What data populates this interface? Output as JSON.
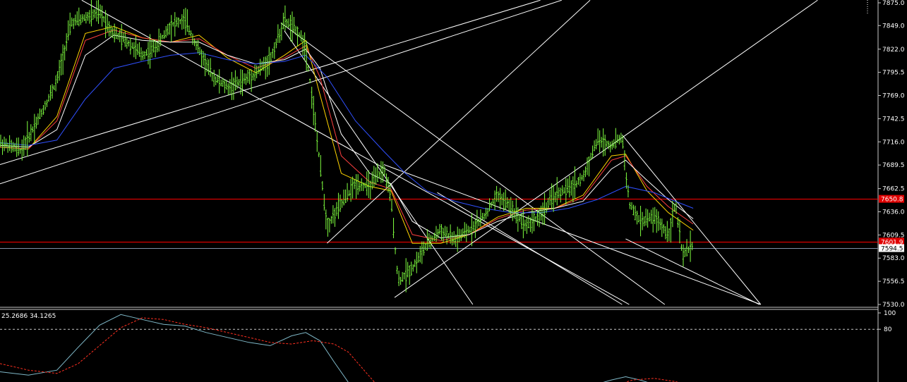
{
  "chart_data": [
    {
      "type": "line",
      "panel": "price",
      "title": "",
      "yticks": [
        7875.0,
        7849.0,
        7822.0,
        7795.5,
        7769.0,
        7742.5,
        7716.0,
        7689.5,
        7662.5,
        7636.0,
        7609.5,
        7583.0,
        7556.5,
        7530.0
      ],
      "ylim": [
        7530.0,
        7878.0
      ],
      "xlim": [
        0,
        1235
      ],
      "grid": false,
      "horizontal_levels": [
        {
          "value": 7650.8,
          "label": "7650.8",
          "color": "#ff0000"
        },
        {
          "value": 7601.9,
          "label": "7601.9",
          "color": "#ff0000"
        },
        {
          "value": 7594.5,
          "label": "7594.5",
          "color": "#7f8fa6"
        }
      ],
      "price_series": {
        "name": "",
        "color": "#7fff3f",
        "x": [
          0,
          30,
          60,
          80,
          100,
          120,
          140,
          160,
          180,
          200,
          220,
          240,
          260,
          280,
          300,
          320,
          340,
          360,
          380,
          400,
          420,
          430,
          440,
          450,
          460,
          480,
          500,
          520,
          540,
          550,
          560,
          580,
          600,
          620,
          640,
          660,
          680,
          700,
          720,
          740,
          760,
          780,
          800,
          820,
          840,
          860,
          875,
          885,
          900,
          920,
          940,
          950,
          960,
          975
        ],
        "y": [
          7715,
          7706,
          7752,
          7785,
          7852,
          7858,
          7864,
          7840,
          7830,
          7815,
          7825,
          7850,
          7855,
          7820,
          7790,
          7778,
          7785,
          7795,
          7810,
          7855,
          7840,
          7825,
          7760,
          7690,
          7620,
          7645,
          7668,
          7665,
          7685,
          7650,
          7556,
          7572,
          7598,
          7615,
          7603,
          7615,
          7630,
          7655,
          7640,
          7620,
          7632,
          7655,
          7662,
          7675,
          7718,
          7712,
          7722,
          7645,
          7625,
          7630,
          7610,
          7645,
          7585,
          7600
        ]
      },
      "moving_averages": [
        {
          "name": "",
          "color": "#ffd400",
          "x": [
            0,
            40,
            80,
            120,
            160,
            200,
            240,
            280,
            320,
            360,
            400,
            430,
            450,
            480,
            520,
            550,
            580,
            620,
            660,
            700,
            740,
            780,
            820,
            860,
            880,
            910,
            940,
            975
          ],
          "y": [
            7710,
            7708,
            7745,
            7840,
            7848,
            7835,
            7830,
            7838,
            7812,
            7795,
            7815,
            7832,
            7770,
            7680,
            7665,
            7660,
            7600,
            7600,
            7610,
            7630,
            7640,
            7640,
            7655,
            7700,
            7702,
            7660,
            7635,
            7615
          ]
        },
        {
          "name": "",
          "color": "#ff4040",
          "x": [
            0,
            40,
            80,
            120,
            160,
            200,
            240,
            280,
            320,
            360,
            400,
            430,
            450,
            480,
            520,
            550,
            580,
            620,
            660,
            700,
            740,
            780,
            820,
            860,
            880,
            910,
            940,
            975
          ],
          "y": [
            7710,
            7708,
            7740,
            7832,
            7844,
            7835,
            7830,
            7834,
            7815,
            7800,
            7812,
            7826,
            7790,
            7700,
            7670,
            7662,
            7610,
            7603,
            7610,
            7628,
            7638,
            7640,
            7652,
            7695,
            7700,
            7665,
            7642,
            7622
          ]
        },
        {
          "name": "",
          "color": "#ffffff",
          "x": [
            0,
            40,
            80,
            120,
            160,
            200,
            240,
            280,
            320,
            360,
            400,
            430,
            450,
            480,
            520,
            550,
            580,
            620,
            660,
            700,
            740,
            780,
            820,
            860,
            880,
            910,
            940,
            975
          ],
          "y": [
            7712,
            7710,
            7730,
            7815,
            7838,
            7832,
            7830,
            7830,
            7815,
            7805,
            7810,
            7822,
            7800,
            7725,
            7680,
            7668,
            7625,
            7606,
            7610,
            7625,
            7635,
            7640,
            7648,
            7685,
            7695,
            7672,
            7650,
            7628
          ]
        },
        {
          "name": "",
          "color": "#3050ff",
          "x": [
            0,
            40,
            80,
            120,
            160,
            200,
            240,
            280,
            320,
            360,
            400,
            430,
            460,
            500,
            540,
            570,
            600,
            640,
            680,
            720,
            760,
            800,
            840,
            880,
            920,
            950,
            975
          ],
          "y": [
            7715,
            7712,
            7718,
            7765,
            7800,
            7808,
            7815,
            7818,
            7810,
            7805,
            7808,
            7815,
            7790,
            7740,
            7705,
            7680,
            7660,
            7648,
            7640,
            7635,
            7635,
            7640,
            7650,
            7665,
            7658,
            7648,
            7640
          ]
        }
      ],
      "trend_lines": [
        {
          "x": [
            0,
            760
          ],
          "y": [
            7690,
            7878
          ]
        },
        {
          "x": [
            0,
            790
          ],
          "y": [
            7668,
            7878
          ]
        },
        {
          "x": [
            115,
            885
          ],
          "y": [
            7878,
            7530
          ]
        },
        {
          "x": [
            395,
            935
          ],
          "y": [
            7852,
            7530
          ]
        },
        {
          "x": [
            400,
            665
          ],
          "y": [
            7843,
            7530
          ]
        },
        {
          "x": [
            460,
            830
          ],
          "y": [
            7600,
            7878
          ]
        },
        {
          "x": [
            555,
            1150
          ],
          "y": [
            7538,
            7878
          ]
        },
        {
          "x": [
            540,
            1070
          ],
          "y": [
            7690,
            7530
          ]
        },
        {
          "x": [
            615,
            875
          ],
          "y": [
            7658,
            7530
          ]
        },
        {
          "x": [
            875,
            1070
          ],
          "y": [
            7724,
            7530
          ]
        },
        {
          "x": [
            880,
            1068
          ],
          "y": [
            7605,
            7530
          ]
        }
      ]
    },
    {
      "type": "line",
      "panel": "oscillator",
      "title": "",
      "header_values": "25.2686 34.1265",
      "yticks": [
        100,
        80
      ],
      "ylim": [
        0,
        100
      ],
      "xlim": [
        0,
        1235
      ],
      "levels": [
        80
      ],
      "series": [
        {
          "name": "",
          "color": "#7fb8c8",
          "style": "solid",
          "x": [
            0,
            40,
            80,
            110,
            140,
            170,
            200,
            230,
            260,
            290,
            320,
            350,
            380,
            410,
            430,
            450,
            470,
            490,
            510,
            540,
            600,
            700,
            760,
            820,
            860,
            880,
            900,
            930,
            960,
            975
          ],
          "y": [
            28,
            24,
            30,
            58,
            85,
            98,
            92,
            86,
            84,
            76,
            70,
            64,
            60,
            72,
            76,
            66,
            40,
            15,
            4,
            -4,
            -8,
            -2,
            4,
            8,
            18,
            22,
            18,
            10,
            -2,
            -6
          ]
        },
        {
          "name": "",
          "color": "#ff3020",
          "style": "dashed",
          "x": [
            0,
            40,
            80,
            110,
            140,
            170,
            200,
            230,
            260,
            290,
            320,
            350,
            380,
            410,
            440,
            470,
            490,
            510,
            530,
            560,
            600,
            700,
            760,
            820,
            860,
            890,
            920,
            950,
            975
          ],
          "y": [
            38,
            30,
            26,
            38,
            60,
            82,
            94,
            92,
            86,
            82,
            76,
            70,
            64,
            62,
            66,
            62,
            52,
            32,
            12,
            -2,
            -6,
            -8,
            -4,
            2,
            10,
            18,
            20,
            16,
            10
          ]
        }
      ]
    }
  ]
}
